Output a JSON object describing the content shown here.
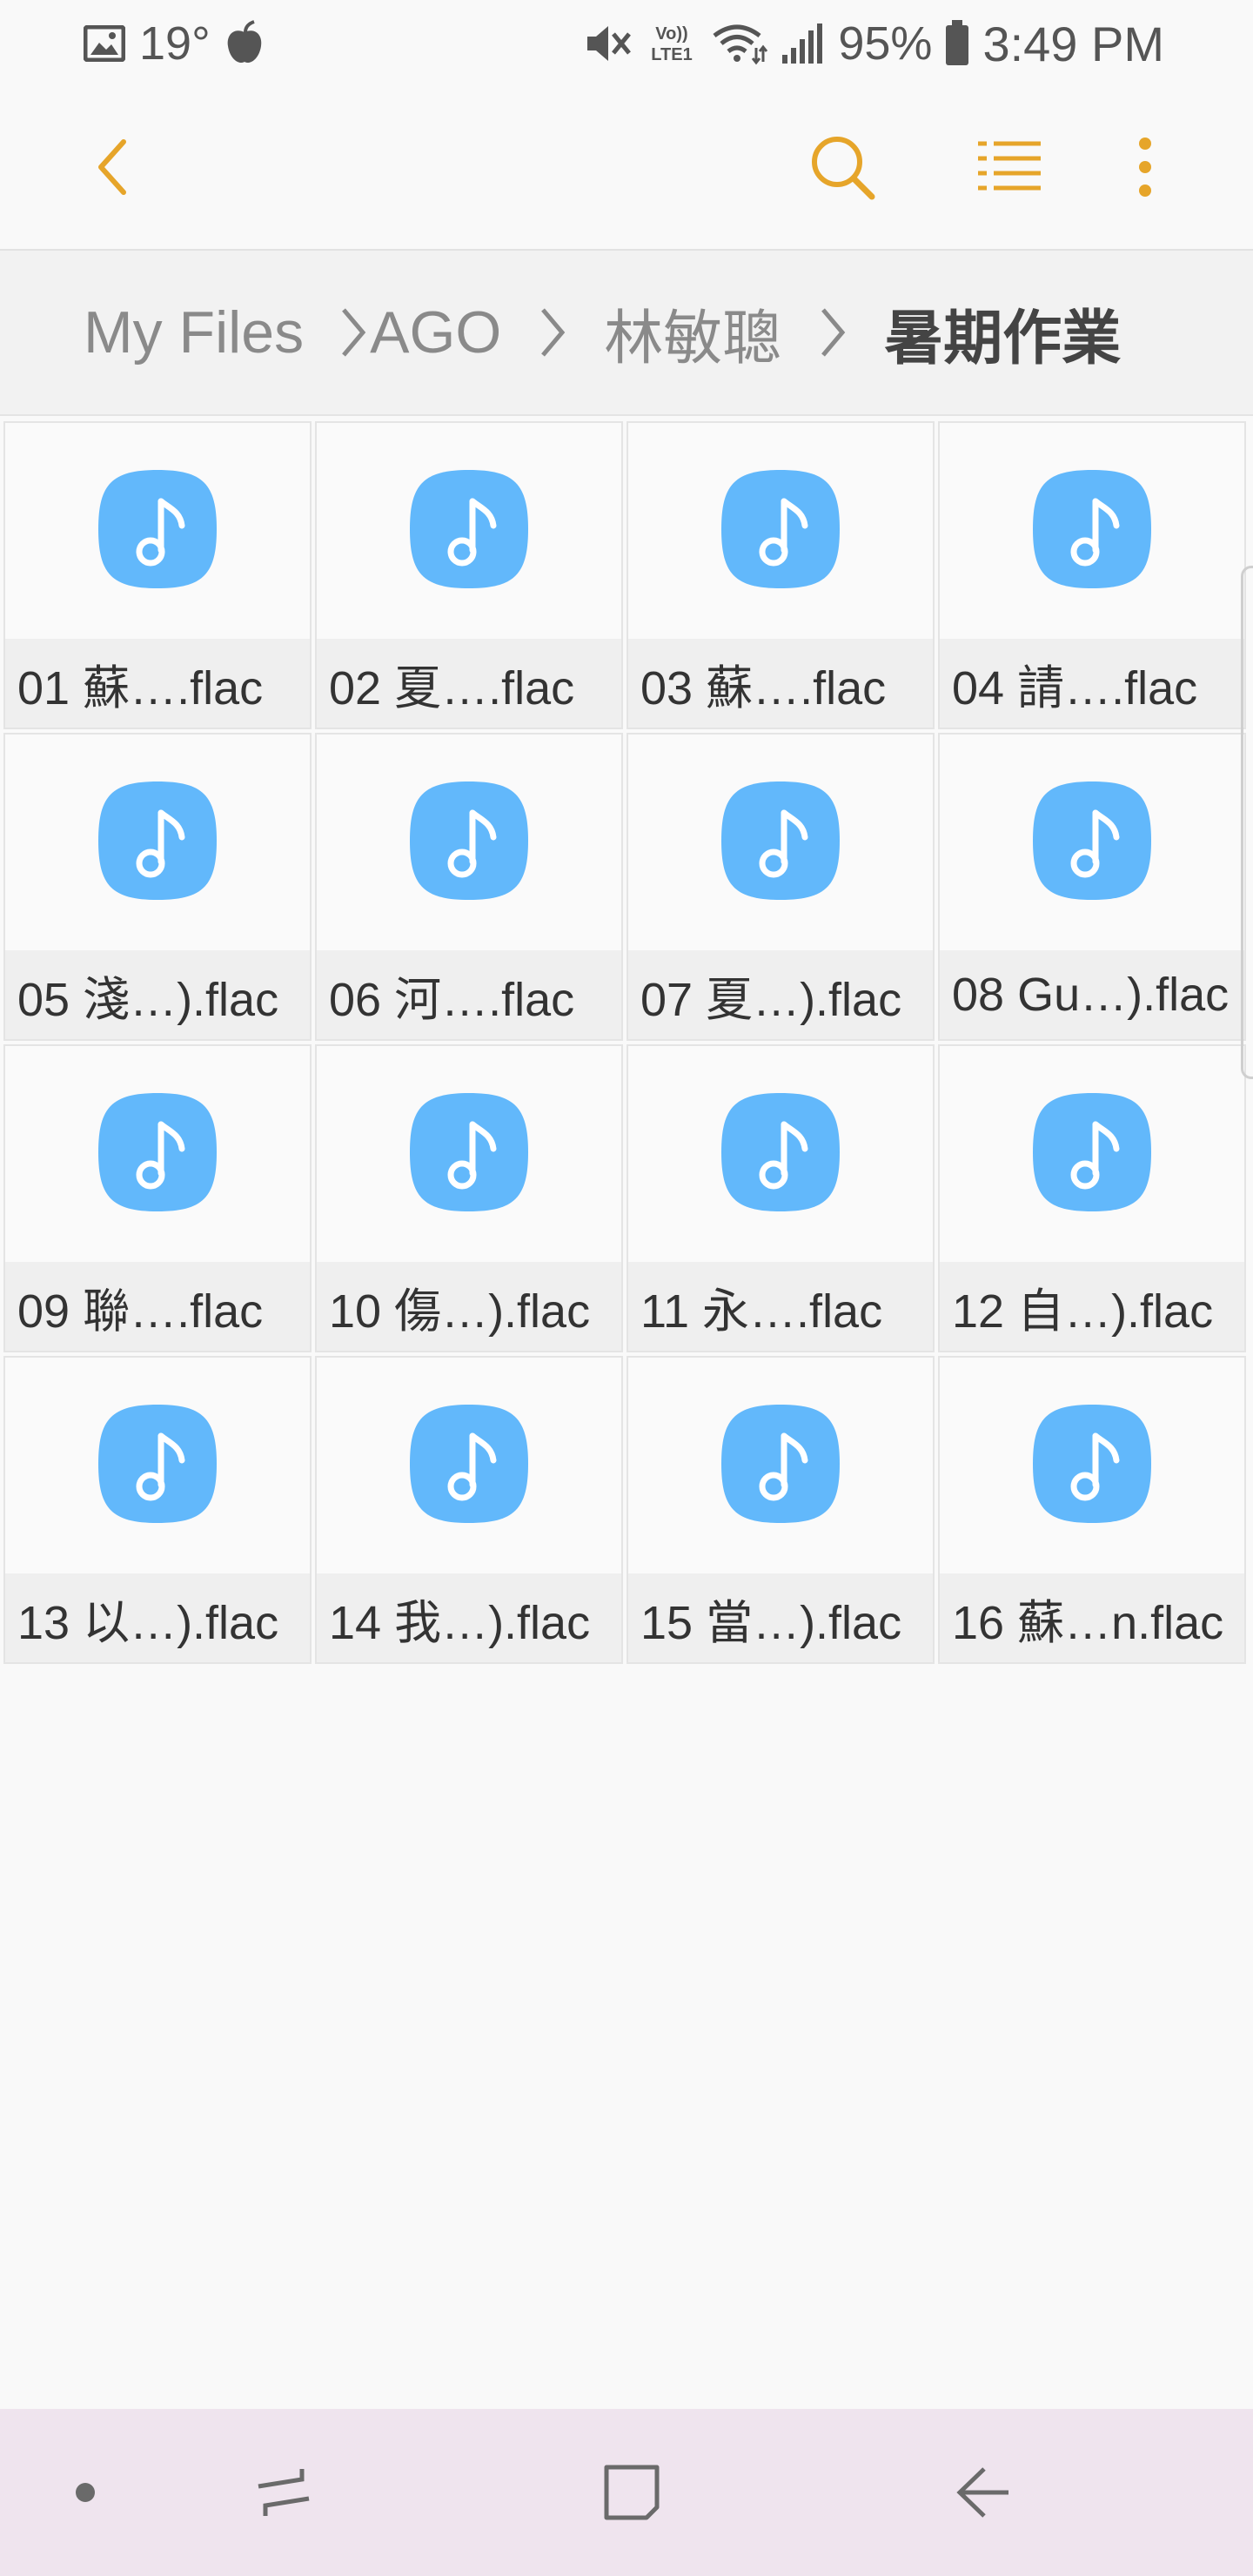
{
  "status_bar": {
    "temperature": "19°",
    "battery": "95%",
    "time": "3:49 PM",
    "icons": [
      "gallery-icon",
      "weather-icon",
      "mute-icon",
      "volte-icon",
      "wifi-icon",
      "signal-icon",
      "battery-icon"
    ],
    "volte_top": "Vo))",
    "volte_bottom": "LTE1"
  },
  "toolbar": {
    "back_icon": "back-arrow-icon",
    "search_icon": "search-icon",
    "list_view_icon": "list-view-icon",
    "more_icon": "more-options-icon",
    "accent_color": "#e6a52a"
  },
  "breadcrumb": {
    "items": [
      "My Files",
      "AGO",
      "林敏聰",
      "暑期作業"
    ]
  },
  "files": [
    {
      "label": "01 蘇….flac"
    },
    {
      "label": "02 夏….flac"
    },
    {
      "label": "03 蘇….flac"
    },
    {
      "label": "04 請….flac"
    },
    {
      "label": "05 淺…).flac"
    },
    {
      "label": "06 河….flac"
    },
    {
      "label": "07 夏…).flac"
    },
    {
      "label": "08 Gu…).flac"
    },
    {
      "label": "09 聯….flac"
    },
    {
      "label": "10 傷…).flac"
    },
    {
      "label": "11 永….flac"
    },
    {
      "label": "12 自…).flac"
    },
    {
      "label": "13 以…).flac"
    },
    {
      "label": "14 我…).flac"
    },
    {
      "label": "15 當…).flac"
    },
    {
      "label": "16 蘇…n.flac"
    }
  ],
  "file_icon": "music-note-icon",
  "file_icon_color": "#62b8fb",
  "nav_bar": {
    "buttons": [
      "dot-icon",
      "recents-icon",
      "home-icon",
      "back-icon"
    ],
    "background": "#efe4ee"
  }
}
